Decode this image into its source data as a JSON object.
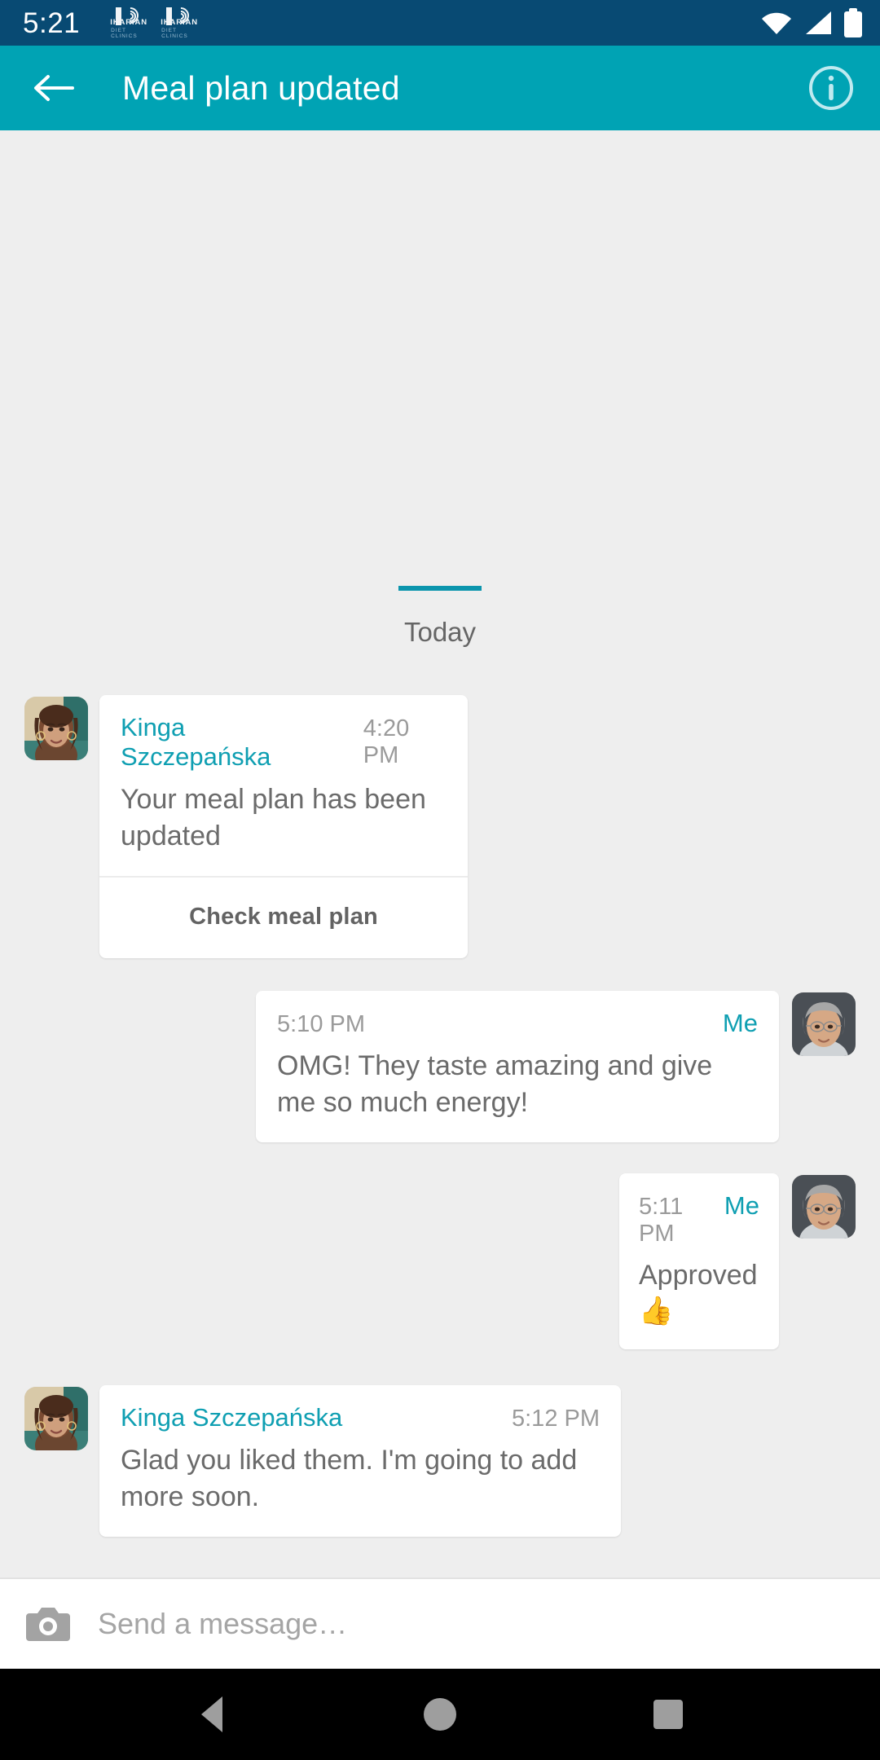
{
  "status_bar": {
    "clock": "5:21",
    "notification_apps": [
      {
        "name": "IKARIAN",
        "subtitle": "DIET CLINICS"
      },
      {
        "name": "IKARIAN",
        "subtitle": "DIET CLINICS"
      }
    ],
    "icons": [
      "wifi-icon",
      "signal-icon",
      "battery-icon"
    ],
    "background_color": "#084a73"
  },
  "app_bar": {
    "title": "Meal plan updated",
    "back_icon": "arrow-left-icon",
    "info_icon": "info-circle-icon",
    "background_color": "#00a3b4"
  },
  "chat": {
    "day_divider": "Today",
    "accent_color": "#0f9fb2",
    "messages": [
      {
        "id": "meal-plan-card",
        "side": "left",
        "sender": "Kinga Szczepańska",
        "time": "4:20 PM",
        "text": "Your meal plan has been updated",
        "action_label": "Check meal plan",
        "avatar": "avatar-kinga"
      },
      {
        "id": "omg-message",
        "side": "right",
        "sender": "Me",
        "time": "5:10 PM",
        "text": "OMG! They taste amazing and give me so much energy!",
        "avatar": "avatar-me"
      },
      {
        "id": "approved-message",
        "side": "right",
        "sender": "Me",
        "time": "5:11 PM",
        "text": "Approved 👍",
        "avatar": "avatar-me"
      },
      {
        "id": "glad-message",
        "side": "left",
        "sender": "Kinga Szczepańska",
        "time": "5:12 PM",
        "text": "Glad you liked them. I'm going to add more soon.",
        "avatar": "avatar-kinga"
      }
    ]
  },
  "composer": {
    "camera_icon": "camera-icon",
    "placeholder": "Send a message…",
    "value": ""
  },
  "nav_bar": {
    "back_icon": "nav-back-icon",
    "home_icon": "nav-home-icon",
    "recents_icon": "nav-recents-icon"
  }
}
